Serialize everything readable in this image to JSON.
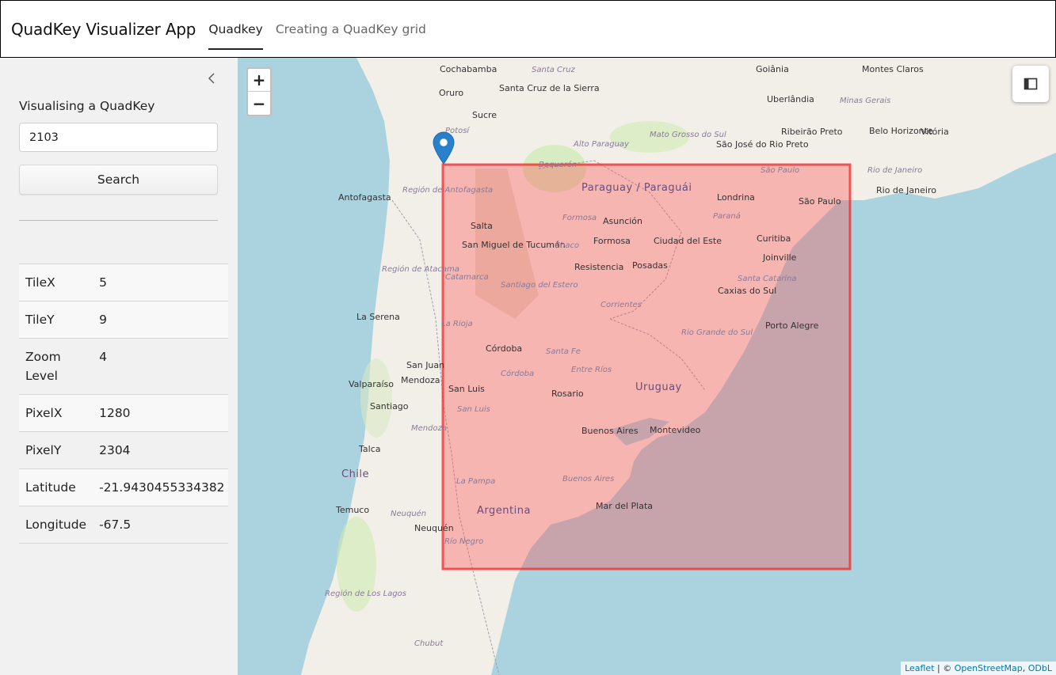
{
  "header": {
    "app_title": "QuadKey Visualizer App",
    "tabs": [
      {
        "label": "Quadkey",
        "active": true
      },
      {
        "label": "Creating a QuadKey grid",
        "active": false
      }
    ]
  },
  "sidebar": {
    "heading": "Visualising a QuadKey",
    "quadkey_input_value": "2103",
    "search_button_label": "Search",
    "info": [
      {
        "key": "TileX",
        "value": "5"
      },
      {
        "key": "TileY",
        "value": "9"
      },
      {
        "key": "Zoom Level",
        "value": "4"
      },
      {
        "key": "PixelX",
        "value": "1280"
      },
      {
        "key": "PixelY",
        "value": "2304"
      },
      {
        "key": "Latitude",
        "value": "-21.9430455334382"
      },
      {
        "key": "Longitude",
        "value": "-67.5"
      }
    ]
  },
  "map": {
    "zoom_in": "+",
    "zoom_out": "−",
    "attribution": {
      "leaflet": "Leaflet",
      "sep": " | © ",
      "osm": "OpenStreetMap",
      "comma": ", ",
      "odbl": "ODbL"
    },
    "colors": {
      "water": "#aad3df",
      "land": "#f2efe9",
      "quadkey_fill": "#ff4a4a",
      "quadkey_stroke": "#ee2a2a",
      "marker": "#2a81cb"
    },
    "labels": {
      "cities": [
        "Cochabamba",
        "Oruro",
        "Sucre",
        "Santa Cruz de la Sierra",
        "Goiânia",
        "Montes Claros",
        "Uberlândia",
        "Ribeirão Preto",
        "Belo Horizonte",
        "Vitória",
        "São José do Rio Preto",
        "Antofagasta",
        "Salta",
        "San Miguel de Tucumán",
        "Asunción",
        "Formosa",
        "Resistencia",
        "Posadas",
        "Ciudad del Este",
        "Londrina",
        "São Paulo",
        "Rio de Janeiro",
        "Curitiba",
        "Joinville",
        "Caxias do Sul",
        "Porto Alegre",
        "La Serena",
        "Córdoba",
        "San Juan",
        "Mendoza",
        "Valparaíso",
        "Santiago",
        "San Luis",
        "Rosario",
        "Buenos Aires",
        "Montevideo",
        "Talca",
        "Temuco",
        "Neuquén",
        "Mar del Plata"
      ],
      "countries": [
        "Paraguay / Paraguái",
        "Uruguay",
        "Argentina",
        "Chile"
      ],
      "regions": [
        "Santa Cruz",
        "Minas Gerais",
        "Alto Paraguay",
        "Mato Grosso do Sul",
        "Boquerón",
        "Rio de Janeiro",
        "São Paulo",
        "Región de Antofagasta",
        "Potosí",
        "Formosa",
        "Paraná",
        "Chaco",
        "Región de Atacama",
        "Catamarca",
        "Santiago del Estero",
        "Santa Catarina",
        "Corrientes",
        "Rio Grande do Sul",
        "La Rioja",
        "Santa Fe",
        "Entre Ríos",
        "Córdoba",
        "San Luis",
        "Mendoza",
        "La Pampa",
        "Buenos Aires",
        "Neuquén",
        "Río Negro",
        "Región de Los Lagos",
        "Chubut"
      ]
    }
  }
}
